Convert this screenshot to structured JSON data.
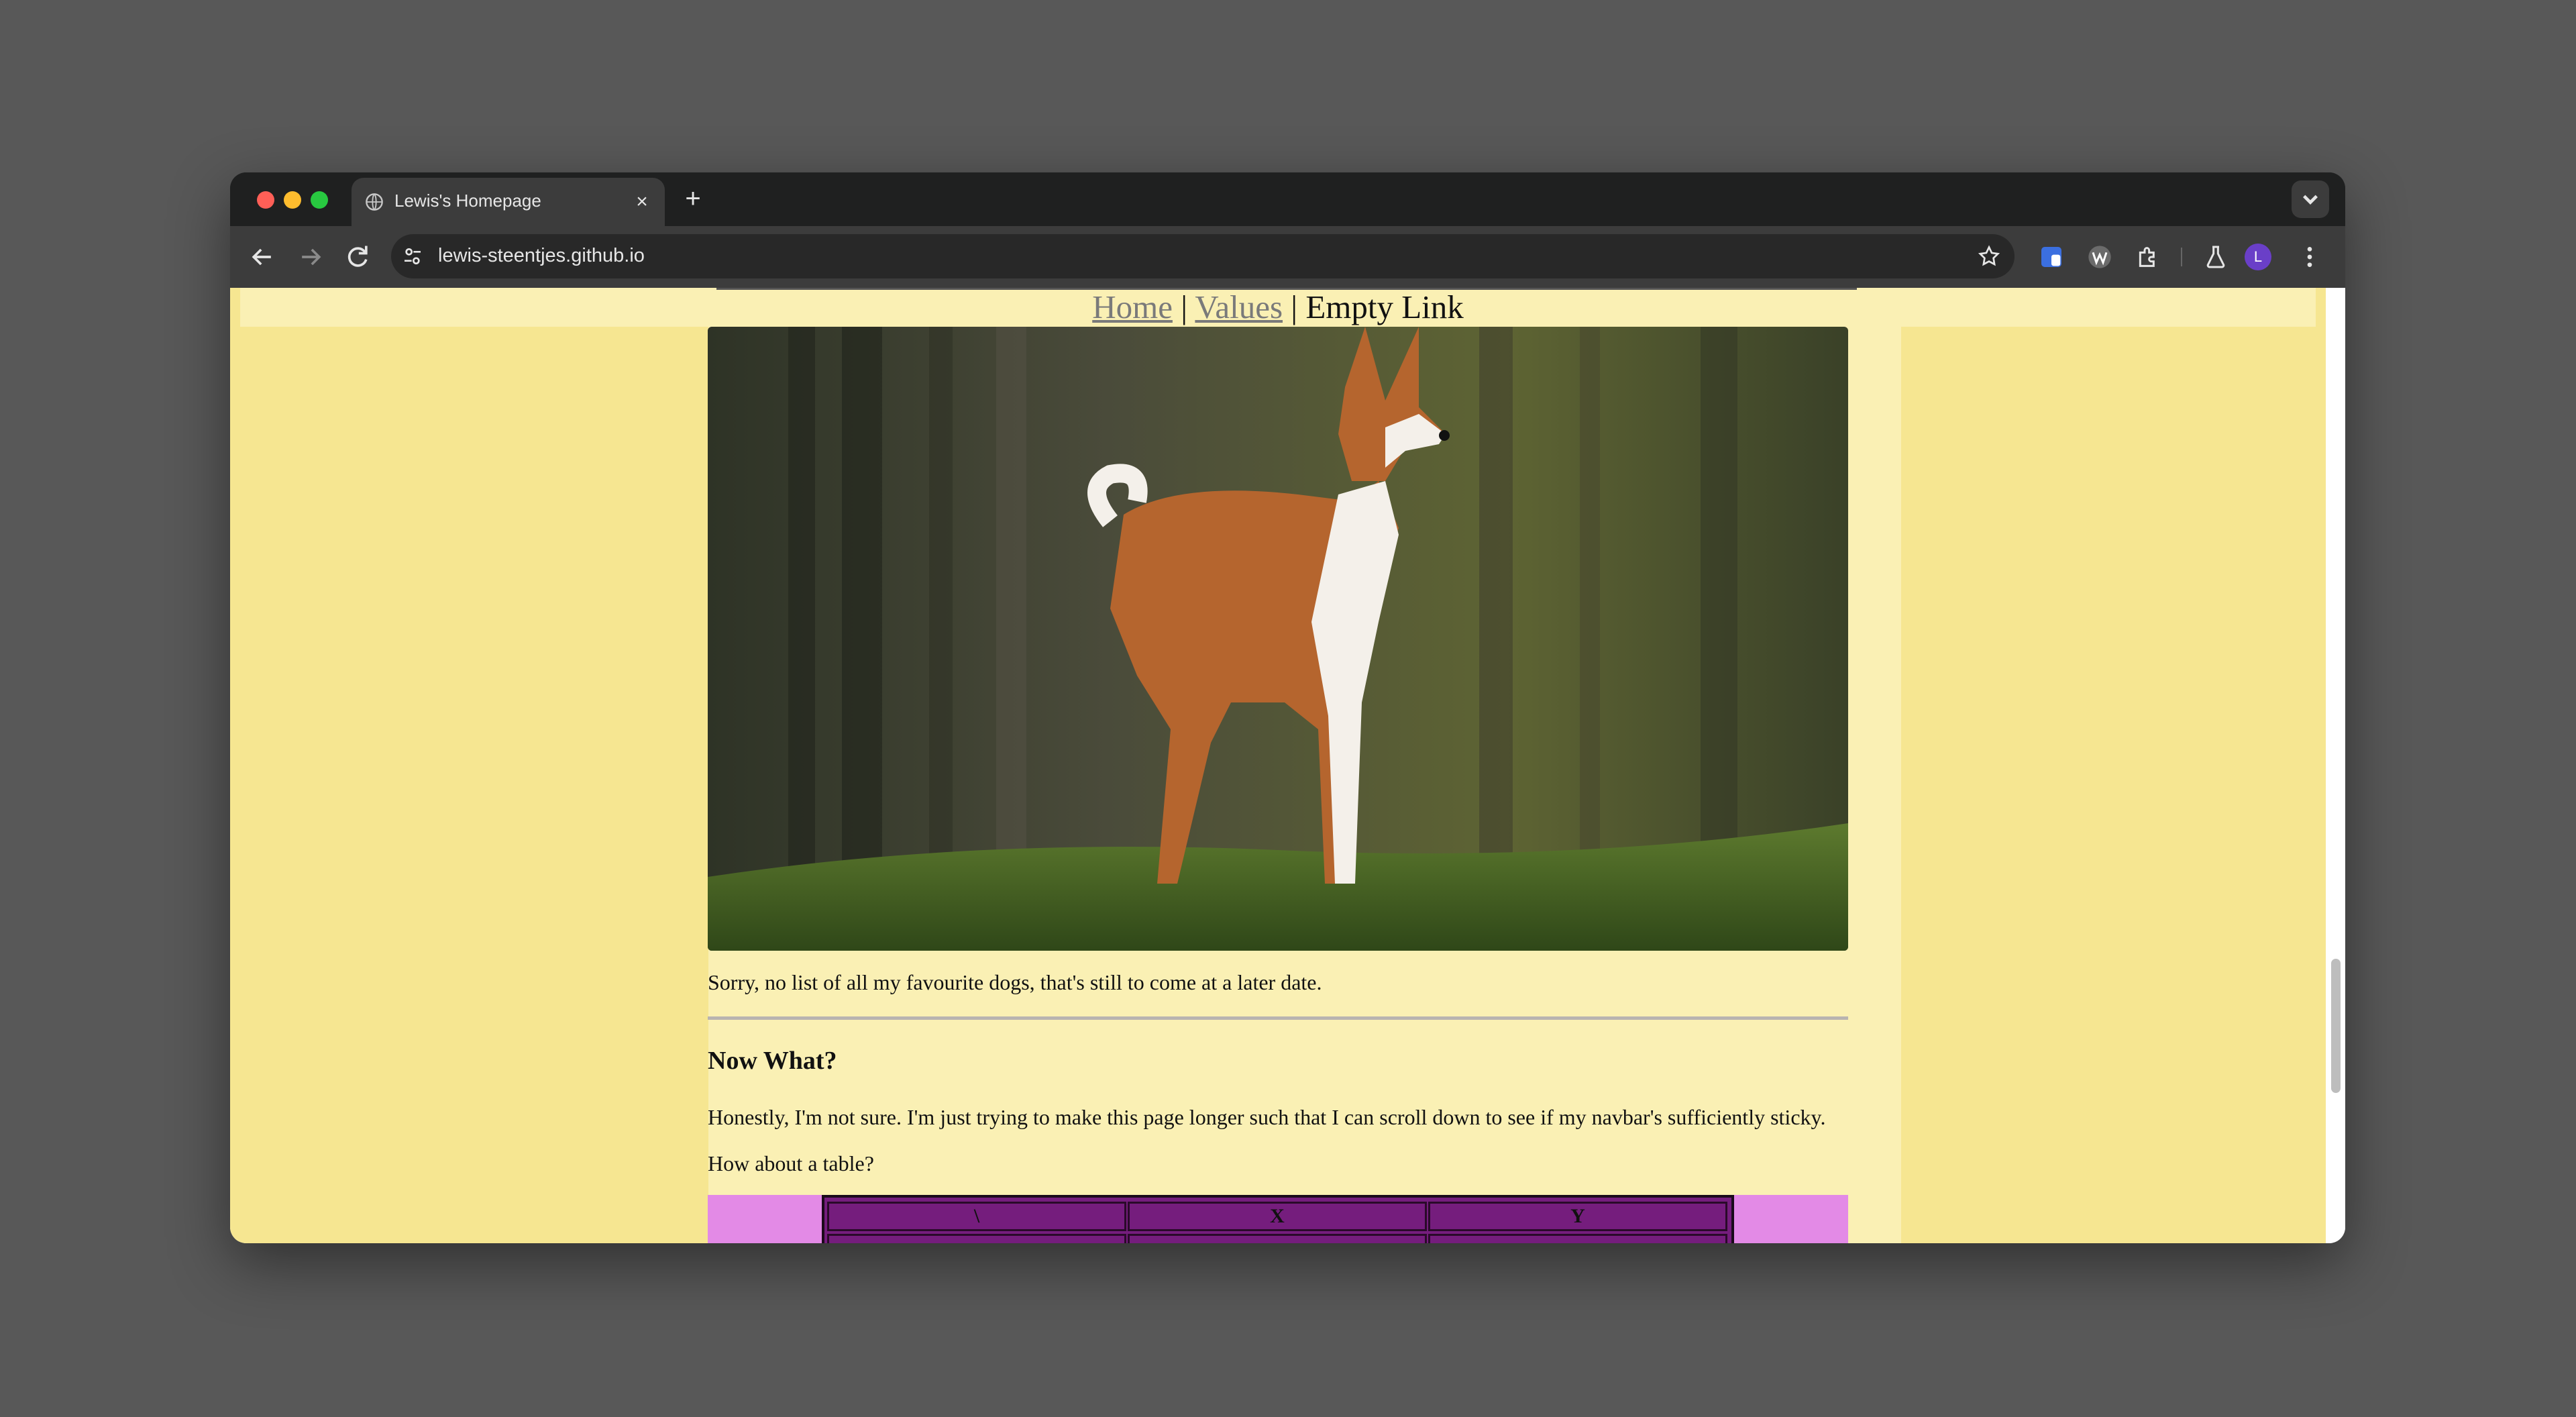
{
  "browser": {
    "tab_title": "Lewis's Homepage",
    "tab_close": "×",
    "new_tab": "+",
    "url": "lewis-steentjes.github.io",
    "avatar_letter": "L"
  },
  "navbar": {
    "home": "Home",
    "sep1": " | ",
    "values": "Values",
    "sep2": " | ",
    "empty": "Empty Link"
  },
  "article": {
    "image_alt": "Basenji dog standing on grass in a forest",
    "para1": "Sorry, no list of all my favourite dogs, that's still to come at a later date.",
    "heading": "Now What?",
    "para2": "Honestly, I'm not sure. I'm just trying to make this page longer such that I can scroll down to see if my navbar's sufficiently sticky.",
    "para3": "How about a table?"
  },
  "table": {
    "headers": [
      "\\",
      "X",
      "Y"
    ]
  },
  "colors": {
    "page_bg": "#f6e691",
    "content_bg": "#faf0b4",
    "table_outer": "#e38ae6",
    "table_inner": "#751d7d"
  }
}
